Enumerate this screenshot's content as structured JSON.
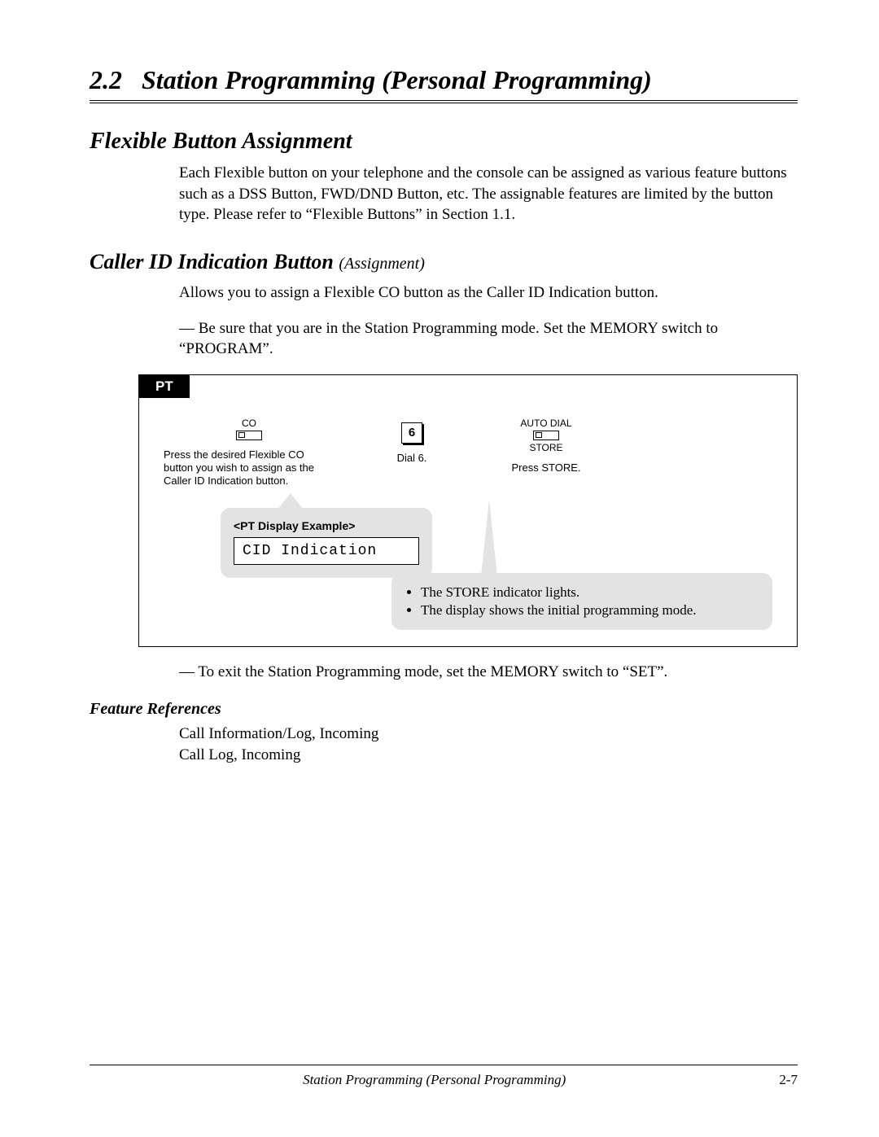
{
  "header": {
    "section_number": "2.2",
    "section_title": "Station Programming (Personal Programming)"
  },
  "fba": {
    "heading": "Flexible Button Assignment",
    "para": "Each Flexible button on your telephone and the console can be assigned as various feature buttons such as a DSS Button, FWD/DND Button, etc. The assignable features are limited by the button type. Please refer to “Flexible Buttons” in Section 1.1."
  },
  "cid": {
    "heading_main": "Caller ID Indication Button ",
    "heading_paren": "(Assignment)",
    "intro": "Allows you to assign a Flexible CO button as the Caller ID Indication button.",
    "note1": "— Be sure that you are in the Station Programming mode. Set the MEMORY switch to “PROGRAM”."
  },
  "pt": {
    "tab": "PT",
    "col1": {
      "top_label": "CO",
      "caption": "Press the desired Flexible CO button you wish to assign as the Caller ID Indication button."
    },
    "col2": {
      "key": "6",
      "caption": "Dial 6."
    },
    "col3": {
      "top_label": "AUTO DIAL",
      "bottom_label": "STORE",
      "caption": "Press STORE."
    },
    "display_example": {
      "title": "<PT Display Example>",
      "lcd": "CID Indication"
    },
    "store_notes": [
      "The STORE indicator lights.",
      "The display shows the initial programming mode."
    ]
  },
  "exit_note": "— To exit the Station Programming mode, set the MEMORY switch to “SET”.",
  "feature_refs": {
    "heading": "Feature References",
    "items": [
      "Call Information/Log, Incoming",
      "Call Log, Incoming"
    ]
  },
  "footer": {
    "title": "Station Programming (Personal Programming)",
    "page": "2-7"
  }
}
